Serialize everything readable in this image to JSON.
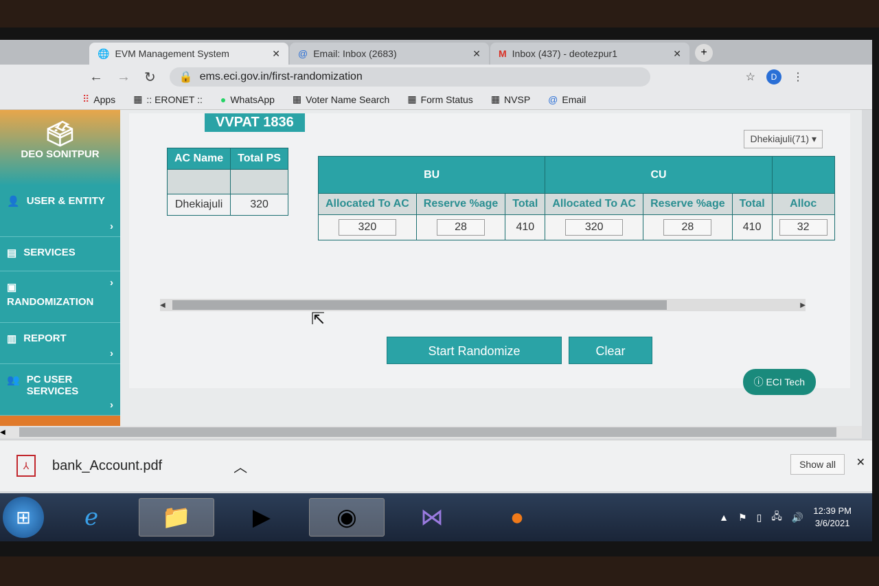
{
  "browser": {
    "tabs": [
      {
        "label": "EVM Management System",
        "icon": "globe-icon",
        "active": true
      },
      {
        "label": "Email: Inbox (2683)",
        "icon": "email-at-icon",
        "active": false
      },
      {
        "label": "Inbox (437) - deotezpur1",
        "icon": "gmail-icon",
        "active": false
      }
    ],
    "url": "ems.eci.gov.in/first-randomization",
    "bookmarks": [
      {
        "label": "Apps",
        "icon": "apps-grid-icon"
      },
      {
        "label": ":: ERONET ::",
        "icon": "eci-icon"
      },
      {
        "label": "WhatsApp",
        "icon": "whatsapp-icon"
      },
      {
        "label": "Voter Name Search",
        "icon": "eci-icon"
      },
      {
        "label": "Form Status",
        "icon": "eci-icon"
      },
      {
        "label": "NVSP",
        "icon": "eci-icon"
      },
      {
        "label": "Email",
        "icon": "email-at-icon"
      }
    ],
    "profile_initial": "D"
  },
  "sidebar": {
    "title": "DEO SONITPUR",
    "items": [
      {
        "label": "USER & ENTITY",
        "icon": "user-icon"
      },
      {
        "label": "SERVICES",
        "icon": "services-icon"
      },
      {
        "label": "RANDOMIZATION",
        "icon": "randomization-icon"
      },
      {
        "label": "REPORT",
        "icon": "report-icon"
      },
      {
        "label": "PC USER SERVICES",
        "icon": "pc-user-icon"
      }
    ]
  },
  "main": {
    "vvpat_label": "VVPAT 1836",
    "ac_select": "Dhekiajuli(71)",
    "left_table": {
      "headers": [
        "AC Name",
        "Total PS"
      ],
      "row": [
        "Dhekiajuli",
        "320"
      ]
    },
    "bu": {
      "title": "BU",
      "headers": [
        "Allocated To AC",
        "Reserve %age",
        "Total"
      ],
      "values": [
        "320",
        "28",
        "410"
      ]
    },
    "cu": {
      "title": "CU",
      "headers": [
        "Allocated To AC",
        "Reserve %age",
        "Total"
      ],
      "values": [
        "320",
        "28",
        "410"
      ]
    },
    "extra": {
      "header": "Alloc",
      "value": "32"
    },
    "start_button": "Start Randomize",
    "clear_button": "Clear",
    "eci_tech": "ECI Tech"
  },
  "download": {
    "filename": "bank_Account.pdf",
    "show_all": "Show all"
  },
  "taskbar": {
    "apps": [
      "internet-explorer",
      "file-explorer",
      "media-player",
      "chrome",
      "visual-studio",
      "firefox"
    ],
    "time": "12:39 PM",
    "date": "3/6/2021"
  }
}
